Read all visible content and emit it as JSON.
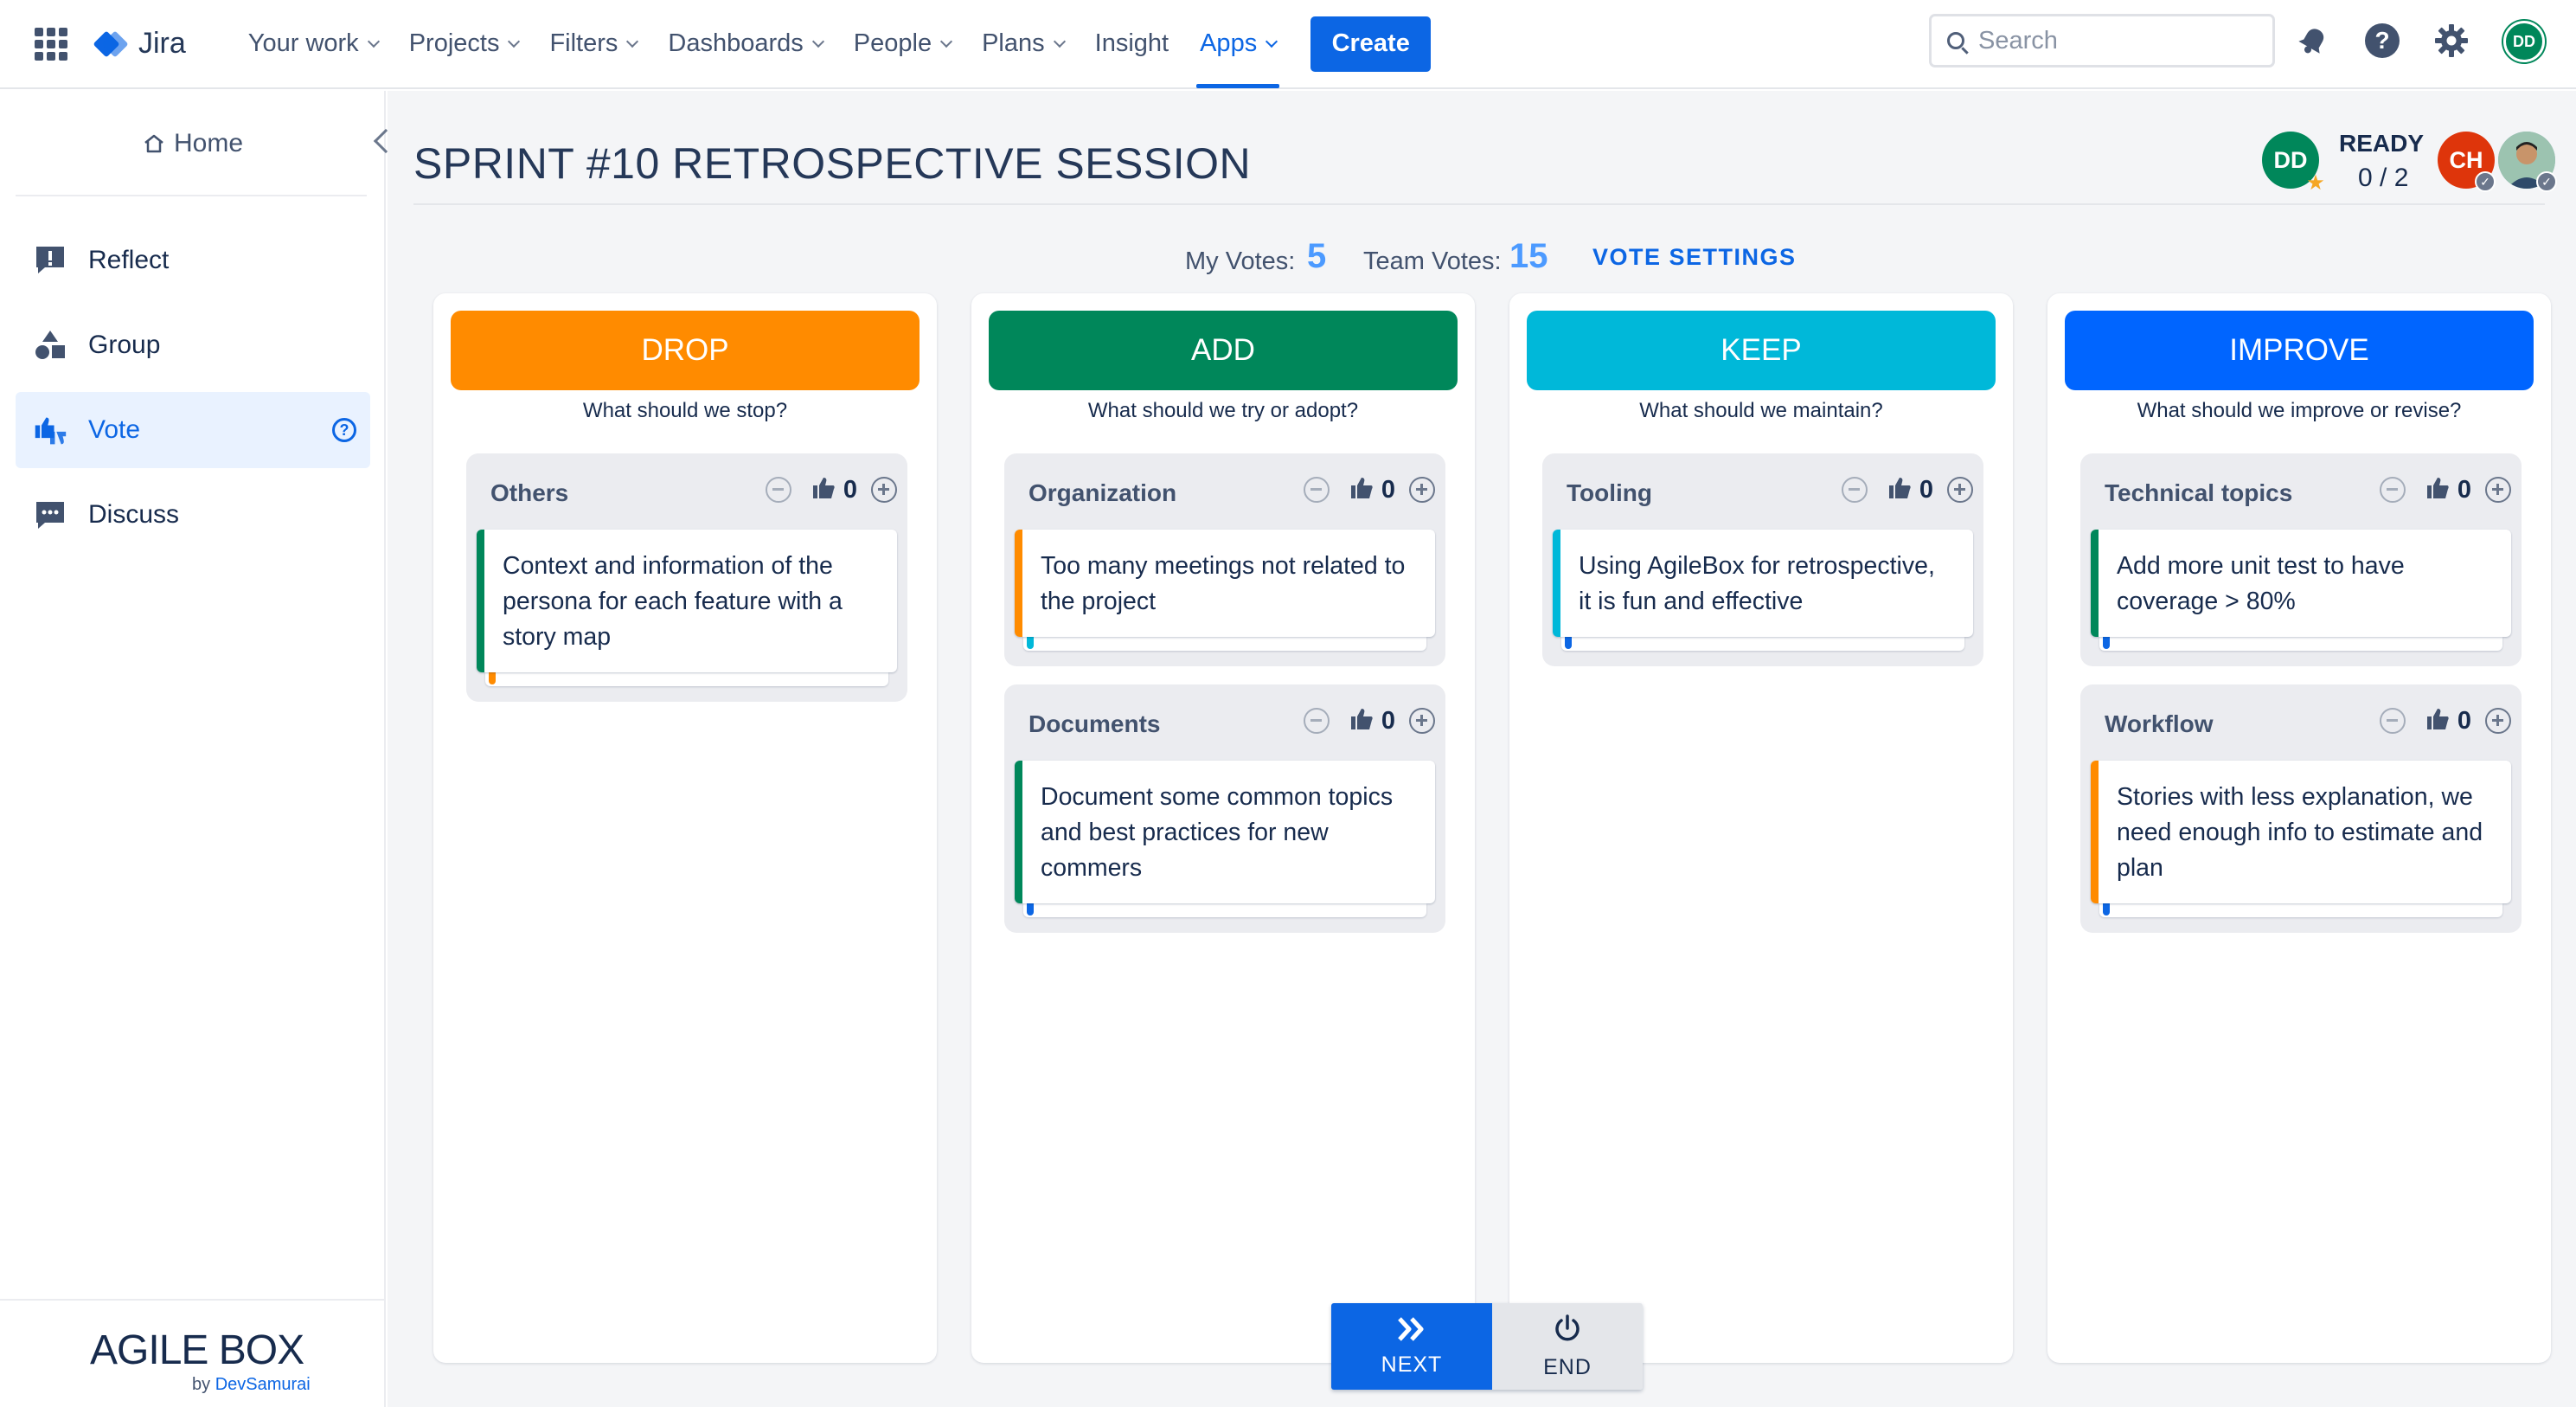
{
  "topnav": {
    "product": "Jira",
    "items": [
      {
        "label": "Your work",
        "chevron": true
      },
      {
        "label": "Projects",
        "chevron": true
      },
      {
        "label": "Filters",
        "chevron": true
      },
      {
        "label": "Dashboards",
        "chevron": true
      },
      {
        "label": "People",
        "chevron": true
      },
      {
        "label": "Plans",
        "chevron": true
      },
      {
        "label": "Insight",
        "chevron": false
      },
      {
        "label": "Apps",
        "chevron": true,
        "active": true
      }
    ],
    "create_label": "Create",
    "search_placeholder": "Search",
    "user_initials": "DD",
    "accent": "#0c66e4"
  },
  "sidebar": {
    "home_label": "Home",
    "items": [
      {
        "label": "Reflect",
        "icon": "reflect-icon"
      },
      {
        "label": "Group",
        "icon": "group-shapes-icon"
      },
      {
        "label": "Vote",
        "icon": "vote-thumbs-icon",
        "active": true
      },
      {
        "label": "Discuss",
        "icon": "discuss-icon"
      }
    ],
    "brand": "AGILE BOX",
    "brand_by": "by",
    "brand_company": "DevSamurai"
  },
  "session": {
    "title": "SPRINT #10 RETROSPECTIVE SESSION",
    "ready_label": "READY",
    "ready_count": "0 / 2",
    "participants": [
      {
        "initials": "DD",
        "color": "#00875a"
      },
      {
        "initials": "CH",
        "color": "#de350b"
      }
    ]
  },
  "votes": {
    "my_label": "My Votes:",
    "my_value": "5",
    "team_label": "Team Votes:",
    "team_value": "15",
    "settings_label": "VOTE SETTINGS"
  },
  "columns": [
    {
      "title": "DROP",
      "color": "#ff8b00",
      "subtitle": "What should we stop?",
      "groups": [
        {
          "name": "Others",
          "votes": "0",
          "card": "Context and information of the persona for each feature with a story map",
          "bar": "#00875a",
          "tick": "#ff8b00"
        }
      ]
    },
    {
      "title": "ADD",
      "color": "#00875a",
      "subtitle": "What should we try or adopt?",
      "groups": [
        {
          "name": "Organization",
          "votes": "0",
          "card": "Too many meetings not related to the project",
          "bar": "#ff8b00",
          "tick": "#00b8d9"
        },
        {
          "name": "Documents",
          "votes": "0",
          "card": "Document some common topics and best practices for new commers",
          "bar": "#00875a",
          "tick": "#0c66e4"
        }
      ]
    },
    {
      "title": "KEEP",
      "color": "#00b8d9",
      "subtitle": "What should we maintain?",
      "groups": [
        {
          "name": "Tooling",
          "votes": "0",
          "card": "Using AgileBox for retrospective, it is fun and effective",
          "bar": "#00b8d9",
          "tick": "#0c66e4"
        }
      ]
    },
    {
      "title": "IMPROVE",
      "color": "#0065ff",
      "subtitle": "What should we improve or revise?",
      "groups": [
        {
          "name": "Technical topics",
          "votes": "0",
          "card": "Add more unit test to have coverage > 80%",
          "bar": "#00875a",
          "tick": "#0c66e4"
        },
        {
          "name": "Workflow",
          "votes": "0",
          "card": "Stories with less explanation, we need enough info to estimate and plan",
          "bar": "#ff8b00",
          "tick": "#0c66e4"
        }
      ]
    }
  ],
  "controls": {
    "next_label": "NEXT",
    "end_label": "END"
  }
}
